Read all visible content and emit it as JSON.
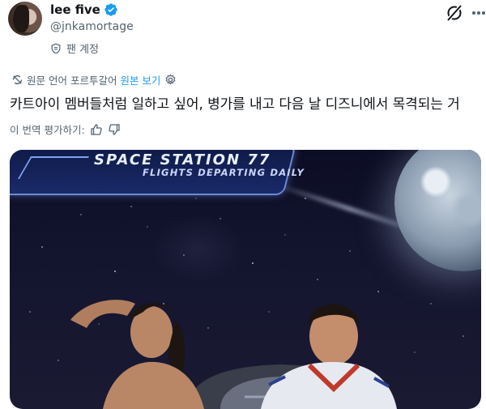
{
  "header": {
    "display_name": "lee five",
    "handle": "@jnkamortage",
    "fan_label": "팬 계정"
  },
  "translation": {
    "source_label": "원문 언어 포르투갈어",
    "view_original": "원본 보기"
  },
  "tweet": {
    "text": "카트아이 멤버들처럼 일하고 싶어, 병가를 내고 다음 날 디즈니에서 목격되는 거"
  },
  "rate": {
    "label": "이 번역 평가하기:"
  },
  "media": {
    "sign_title": "SPACE STATION 77",
    "sign_subtitle": "FLIGHTS DEPARTING DAILY"
  },
  "icons": {
    "verified": "verified-badge-icon",
    "grok": "grok-icon",
    "more": "more-options-icon",
    "translate": "translate-icon",
    "settings": "gear-icon",
    "thumbs_up": "thumbs-up-icon",
    "thumbs_down": "thumbs-down-icon",
    "fan": "fan-badge-icon"
  },
  "colors": {
    "accent": "#1d9bf0",
    "text": "#0f1419",
    "muted": "#536471"
  }
}
